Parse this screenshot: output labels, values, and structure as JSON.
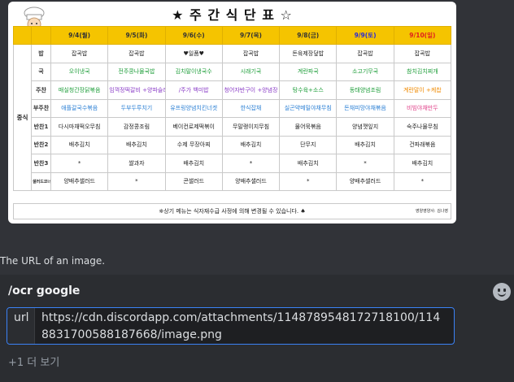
{
  "menu_image": {
    "title": "★ 주 간 식 단 표 ☆",
    "group_label": "중식",
    "days": [
      "9/4(월)",
      "9/5(화)",
      "9/6(수)",
      "9/7(목)",
      "9/8(금)",
      "9/9(토)",
      "9/10(일)"
    ],
    "rows": [
      {
        "label": "밥",
        "cells": [
          [
            "잡곡밥",
            "black"
          ],
          [
            "잡곡밥",
            "black"
          ],
          [
            "♥일품♥",
            "black"
          ],
          [
            "잡곡밥",
            "black"
          ],
          [
            "돈육제장덮밥",
            "black"
          ],
          [
            "잡곡밥",
            "black"
          ],
          [
            "잡곡밥",
            "black"
          ]
        ]
      },
      {
        "label": "국",
        "cells": [
          [
            "오이냉국",
            "green"
          ],
          [
            "전주콩나물국밥",
            "green"
          ],
          [
            "김치말이냉국수",
            "green"
          ],
          [
            "시래기국",
            "green"
          ],
          [
            "계란파국",
            "green"
          ],
          [
            "소고기무국",
            "green"
          ],
          [
            "참치김치찌개",
            "green"
          ]
        ]
      },
      {
        "label": "주찬",
        "cells": [
          [
            "매실청간장닭볶음",
            "green"
          ],
          [
            "임꺽정떡갈비 +양파슬라이스",
            "purple"
          ],
          [
            "/주가 백미밥",
            "purple"
          ],
          [
            "청어자반구이 +양념장",
            "purple"
          ],
          [
            "탕수육+소스",
            "green"
          ],
          [
            "동태양념조림",
            "green"
          ],
          [
            "계란말이 +케찹",
            "orange"
          ]
        ]
      },
      {
        "label": "부주찬",
        "cells": [
          [
            "애플갈국수볶음",
            "blue"
          ],
          [
            "두부두루치기",
            "blue"
          ],
          [
            "유프링양념치킨너겟",
            "blue"
          ],
          [
            "한식잡채",
            "blue"
          ],
          [
            "실곤약메밀야채무침",
            "blue"
          ],
          [
            "돈채피망야채볶음",
            "blue"
          ],
          [
            "비빔야채만두",
            "pink"
          ]
        ]
      },
      {
        "label": "반찬1",
        "cells": [
          [
            "다시마채떡오무침",
            "black"
          ],
          [
            "감정콩조림",
            "black"
          ],
          [
            "베이컨로제떡볶이",
            "black"
          ],
          [
            "무말랭이지무침",
            "black"
          ],
          [
            "물어묵볶음",
            "black"
          ],
          [
            "양념깻잎지",
            "black"
          ],
          [
            "숙주나물무침",
            "black"
          ]
        ]
      },
      {
        "label": "반찬2",
        "cells": [
          [
            "배추김치",
            "black"
          ],
          [
            "배추김치",
            "black"
          ],
          [
            "수제 무장아찌",
            "black"
          ],
          [
            "배추김치",
            "black"
          ],
          [
            "단무지",
            "black"
          ],
          [
            "배추김치",
            "black"
          ],
          [
            "건파래볶음",
            "black"
          ]
        ]
      },
      {
        "label": "반찬3",
        "cells": [
          [
            "*",
            "black"
          ],
          [
            "쌀과자",
            "black"
          ],
          [
            "배추김치",
            "black"
          ],
          [
            "*",
            "black"
          ],
          [
            "배추김치",
            "black"
          ],
          [
            "*",
            "black"
          ],
          [
            "배추김치",
            "black"
          ]
        ]
      },
      {
        "label": "샐러드코너",
        "cells": [
          [
            "양배추샐러드",
            "black"
          ],
          [
            "*",
            "black"
          ],
          [
            "콘샐러드",
            "black"
          ],
          [
            "양배추샐러드",
            "black"
          ],
          [
            "*",
            "black"
          ],
          [
            "양배추샐러드",
            "black"
          ],
          [
            "*",
            "black"
          ]
        ]
      }
    ],
    "footer_note": "※상기 메뉴는 식자재수급 사정에 의해 변경될 수 있습니다. ♠",
    "author": "영양영양사: 김나영"
  },
  "caption": "The URL of an image.",
  "command": {
    "title": "/ocr google",
    "option_label": "url",
    "option_value": "https://cdn.discordapp.com/attachments/1148789548172718100/1148831700588187668/image.png",
    "more_label": "+1 더 보기"
  },
  "colors": {
    "black": "#222222",
    "green": "#1e9e3a",
    "purple": "#8a3cc7",
    "blue": "#2a7fd4",
    "pink": "#e0418a",
    "orange": "#f08a00",
    "header_yellow": "#f5c400",
    "saturday": "#2b2bd8",
    "sunday": "#e01e1e",
    "focus_border": "#3b82f6"
  },
  "icons": {
    "chef": "chef-illustration",
    "emoji": "smiley-emoji-icon"
  }
}
